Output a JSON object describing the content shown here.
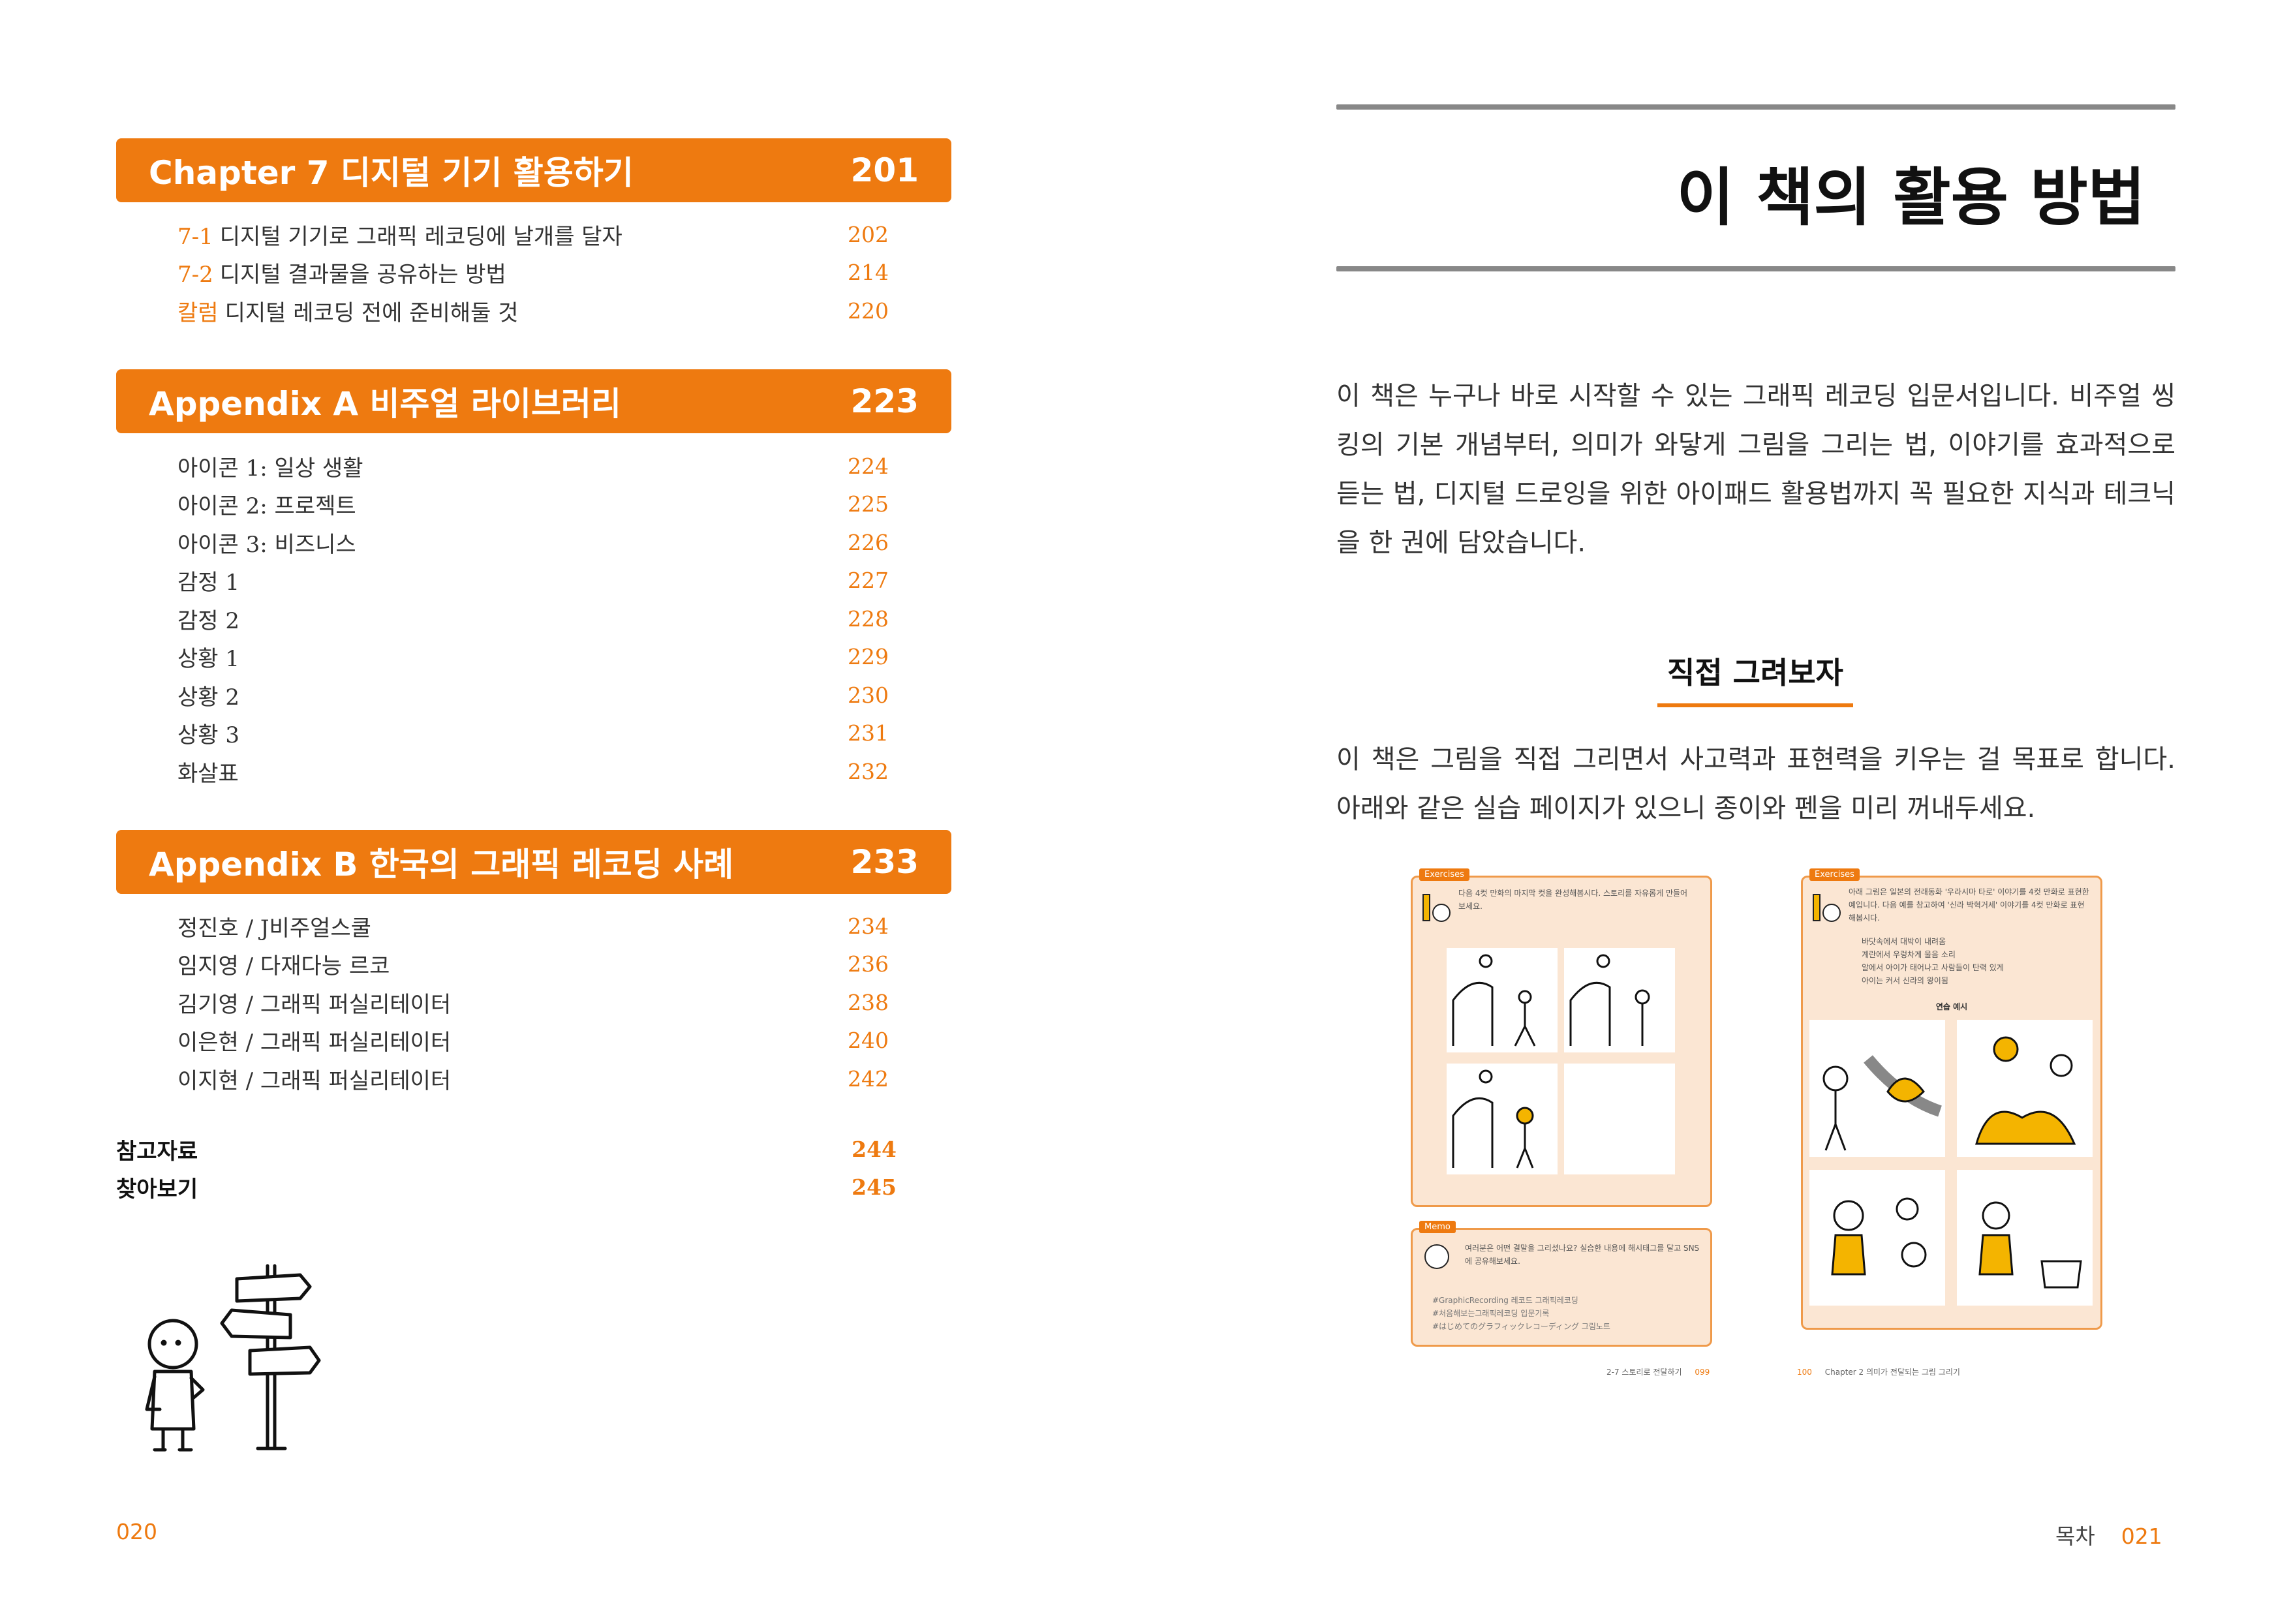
{
  "toc": {
    "chapter7": {
      "title": "Chapter 7 디지털 기기 활용하기",
      "page": "201",
      "items": [
        {
          "prefix": "7-1",
          "label": "디지털 기기로 그래픽 레코딩에 날개를 달자",
          "page": "202"
        },
        {
          "prefix": "7-2",
          "label": "디지털 결과물을 공유하는 방법",
          "page": "214"
        },
        {
          "prefix": "칼럼",
          "label": "디지털 레코딩 전에 준비해둘 것",
          "page": "220"
        }
      ]
    },
    "appendixA": {
      "title": "Appendix A 비주얼 라이브러리",
      "page": "223",
      "items": [
        {
          "label": "아이콘 1: 일상 생활",
          "page": "224"
        },
        {
          "label": "아이콘 2: 프로젝트",
          "page": "225"
        },
        {
          "label": "아이콘 3: 비즈니스",
          "page": "226"
        },
        {
          "label": "감정 1",
          "page": "227"
        },
        {
          "label": "감정 2",
          "page": "228"
        },
        {
          "label": "상황 1",
          "page": "229"
        },
        {
          "label": "상황 2",
          "page": "230"
        },
        {
          "label": "상황 3",
          "page": "231"
        },
        {
          "label": "화살표",
          "page": "232"
        }
      ]
    },
    "appendixB": {
      "title": "Appendix B 한국의 그래픽 레코딩 사례",
      "page": "233",
      "items": [
        {
          "label": "정진호 / J비주얼스쿨",
          "page": "234"
        },
        {
          "label": "임지영 / 다재다능 르코",
          "page": "236"
        },
        {
          "label": "김기영 / 그래픽 퍼실리테이터",
          "page": "238"
        },
        {
          "label": "이은현 / 그래픽 퍼실리테이터",
          "page": "240"
        },
        {
          "label": "이지현 / 그래픽 퍼실리테이터",
          "page": "242"
        }
      ]
    },
    "extras": [
      {
        "label": "참고자료",
        "page": "244"
      },
      {
        "label": "찾아보기",
        "page": "245"
      }
    ]
  },
  "left_folio": "020",
  "right": {
    "title": "이 책의 활용 방법",
    "intro": "이 책은 누구나 바로 시작할 수 있는 그래픽 레코딩 입문서입니다. 비주얼 씽킹의 기본 개념부터, 의미가 와닿게 그림을 그리는 법, 이야기를 효과적으로 듣는 법, 디지털 드로잉을 위한 아이패드 활용법까지 꼭 필요한 지식과 테크닉을 한 권에 담았습니다.",
    "subhead": "직접 그려보자",
    "body": "이 책은 그림을 직접 그리면서 사고력과 표현력을 키우는 걸 목표로 합니다. 아래와 같은 실습 페이지가 있으니 종이와 펜을 미리 꺼내두세요.",
    "folio_label": "목차",
    "folio_num": "021"
  },
  "thumbs": {
    "tag_exercises": "Exercises",
    "tag_memo": "Memo",
    "ex1_text": "다음 4컷 만화의 마지막 컷을 완성해봅시다. 스토리를 자유롭게 만들어 보세요.",
    "ex2_text": "아래 그림은 일본의 전래동화 '우라시마 타로' 이야기를 4컷 만화로 표현한 예입니다. 다음 예를 참고하여 '신라 박혁거세' 이야기를 4컷 만화로 표현해봅시다.",
    "ex2_bullets": [
      "바닷속에서 대박이 내려옴",
      "계란에서 우렁차게 울음 소리",
      "알에서 아이가 태어나고 사람들이 탄력 있게",
      "아이는 커서 신라의 왕이됨"
    ],
    "ex2_example": "연습 예시",
    "memo_text": "여러분은 어떤 결말을 그리셨나요? 실습한 내용에 해시태그를 달고 SNS에 공유해보세요.",
    "memo_tags": [
      "#GraphicRecording 레코드 그래픽레코딩",
      "#처음해보는그래픽레코딩 입문기록",
      "#はじめてのグラフィックレコーディング 그림노트"
    ],
    "foot_left": "2-7 스토리로 전달하기",
    "foot_left_num": "099",
    "foot_right_num": "100",
    "foot_right": "Chapter 2 의미가 전달되는 그림 그리기"
  }
}
